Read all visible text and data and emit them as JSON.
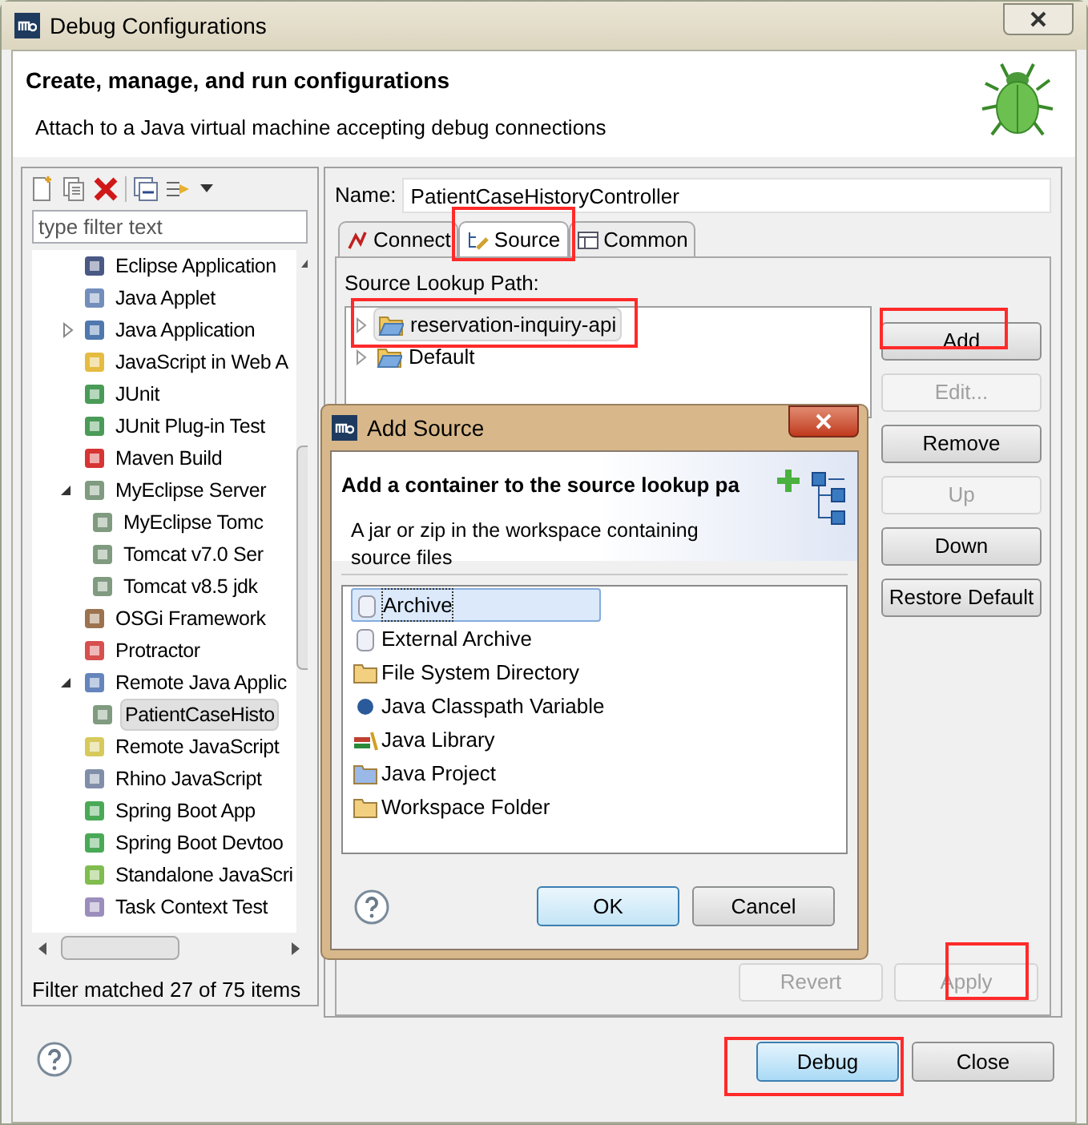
{
  "window": {
    "title": "Debug Configurations"
  },
  "header": {
    "title": "Create, manage, and run configurations",
    "subtitle": "Attach to a Java virtual machine accepting debug connections"
  },
  "filter": {
    "placeholder": "type filter text"
  },
  "config_tree": [
    {
      "label": "Eclipse Application",
      "selected": false
    },
    {
      "label": "Java Applet",
      "selected": false
    },
    {
      "label": "Java Application",
      "selected": false,
      "expanded": false
    },
    {
      "label": "JavaScript in Web A",
      "selected": false
    },
    {
      "label": "JUnit",
      "selected": false
    },
    {
      "label": "JUnit Plug-in Test",
      "selected": false
    },
    {
      "label": "Maven Build",
      "selected": false
    },
    {
      "label": "MyEclipse Server",
      "selected": false,
      "expanded": true,
      "children": [
        {
          "label": "MyEclipse Tomc",
          "selected": false
        },
        {
          "label": "Tomcat v7.0 Ser",
          "selected": false
        },
        {
          "label": "Tomcat v8.5 jdk",
          "selected": false
        }
      ]
    },
    {
      "label": "OSGi Framework",
      "selected": false
    },
    {
      "label": "Protractor",
      "selected": false
    },
    {
      "label": "Remote Java Applic",
      "selected": false,
      "expanded": true,
      "children": [
        {
          "label": "PatientCaseHisto",
          "selected": true
        }
      ]
    },
    {
      "label": "Remote JavaScript",
      "selected": false
    },
    {
      "label": "Rhino JavaScript",
      "selected": false
    },
    {
      "label": "Spring Boot App",
      "selected": false
    },
    {
      "label": "Spring Boot Devtoo",
      "selected": false
    },
    {
      "label": "Standalone JavaScri",
      "selected": false
    },
    {
      "label": "Task Context Test",
      "selected": false
    }
  ],
  "filter_status": "Filter matched 27 of 75 items",
  "name_field": {
    "label": "Name:",
    "value": "PatientCaseHistoryController"
  },
  "tabs": [
    {
      "label": "Connect",
      "selected": false,
      "highlighted": false
    },
    {
      "label": "Source",
      "selected": true,
      "highlighted": true
    },
    {
      "label": "Common",
      "selected": false,
      "highlighted": false
    }
  ],
  "source_lookup": {
    "label": "Source Lookup Path:",
    "items": [
      {
        "label": "reservation-inquiry-api",
        "selected": true,
        "highlighted": true
      },
      {
        "label": "Default",
        "selected": false,
        "highlighted": false
      }
    ]
  },
  "side_buttons": [
    {
      "label": "Add",
      "disabled": false,
      "highlighted": true
    },
    {
      "label": "Edit...",
      "disabled": true,
      "highlighted": false
    },
    {
      "label": "Remove",
      "disabled": false,
      "highlighted": false
    },
    {
      "label": "Up",
      "disabled": true,
      "highlighted": false
    },
    {
      "label": "Down",
      "disabled": false,
      "highlighted": false
    },
    {
      "label": "Restore Default",
      "disabled": false,
      "highlighted": false
    }
  ],
  "revert_apply": [
    {
      "label": "Revert",
      "disabled": true,
      "highlighted": false
    },
    {
      "label": "Apply",
      "disabled": true,
      "highlighted": true
    }
  ],
  "dialog_buttons": [
    {
      "label": "Debug",
      "default": true,
      "highlighted": true
    },
    {
      "label": "Close",
      "default": false,
      "highlighted": false
    }
  ],
  "add_source": {
    "title": "Add Source",
    "header_title": "Add a container to the source lookup pa",
    "description": "A jar or zip in the workspace containing source files",
    "types": [
      {
        "label": "Archive",
        "selected": true
      },
      {
        "label": "External Archive",
        "selected": false
      },
      {
        "label": "File System Directory",
        "selected": false
      },
      {
        "label": "Java Classpath Variable",
        "selected": false
      },
      {
        "label": "Java Library",
        "selected": false
      },
      {
        "label": "Java Project",
        "selected": false
      },
      {
        "label": "Workspace Folder",
        "selected": false
      }
    ],
    "buttons": [
      {
        "label": "OK",
        "default": true
      },
      {
        "label": "Cancel",
        "default": false
      }
    ]
  }
}
